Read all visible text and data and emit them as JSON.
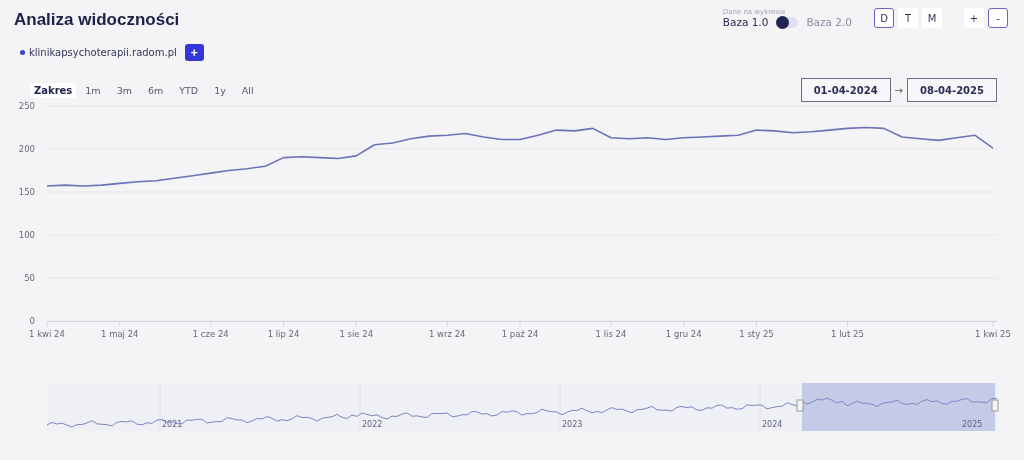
{
  "header": {
    "title": "Analiza widoczności"
  },
  "data_source": {
    "caption": "Dane na wykresie",
    "options": [
      {
        "label": "Baza 1.0",
        "selected": true
      },
      {
        "label": "Baza 2.0",
        "selected": false
      }
    ]
  },
  "granularity": [
    {
      "label": "D",
      "selected": true
    },
    {
      "label": "T",
      "selected": false
    },
    {
      "label": "M",
      "selected": false
    }
  ],
  "zoom_buttons": [
    {
      "label": "+",
      "selected": false
    },
    {
      "label": "-",
      "selected": true
    }
  ],
  "domains": [
    {
      "label": "klinikapsychoterapii.radom.pl",
      "color": "#3a3fe0"
    }
  ],
  "add_button": {
    "label": "+"
  },
  "range": {
    "label": "Zakres",
    "options": [
      "1m",
      "3m",
      "6m",
      "YTD",
      "1y",
      "All"
    ],
    "from": "01-04-2024",
    "arrow": "→",
    "to": "08-04-2025"
  },
  "chart": {
    "chart_data": {
      "type": "line",
      "categories": [
        "1 kwi 24",
        null,
        null,
        null,
        "1 maj 24",
        null,
        null,
        null,
        null,
        "1 cze 24",
        null,
        null,
        null,
        "1 lip 24",
        null,
        null,
        null,
        "1 sie 24",
        null,
        null,
        null,
        null,
        "1 wrz 24",
        null,
        null,
        null,
        "1 paź 24",
        null,
        null,
        null,
        null,
        "1 lis 24",
        null,
        null,
        null,
        "1 gru 24",
        null,
        null,
        null,
        "1 sty 25",
        null,
        null,
        null,
        null,
        "1 lut 25",
        null,
        null,
        null,
        null,
        null,
        null,
        null,
        "1 kwi 25"
      ],
      "series": [
        {
          "color": "#6b72b8",
          "values": [
            157,
            158,
            157,
            158,
            160,
            162,
            163,
            166,
            169,
            172,
            175,
            177,
            180,
            190,
            191,
            190,
            189,
            192,
            205,
            207,
            212,
            215,
            216,
            218,
            214,
            211,
            211,
            216,
            222,
            221,
            224,
            213,
            212,
            213,
            211,
            213,
            214,
            215,
            216,
            222,
            221,
            219,
            220,
            222,
            224,
            225,
            224,
            214,
            212,
            210,
            213,
            216,
            201
          ]
        }
      ],
      "ylim": [
        0,
        250
      ],
      "grid": true,
      "yticks": [
        0,
        50,
        100,
        150,
        200,
        250
      ]
    }
  },
  "navigator": {
    "year_labels": [
      "2021",
      "2022",
      "2023",
      "2024",
      "2025"
    ]
  }
}
